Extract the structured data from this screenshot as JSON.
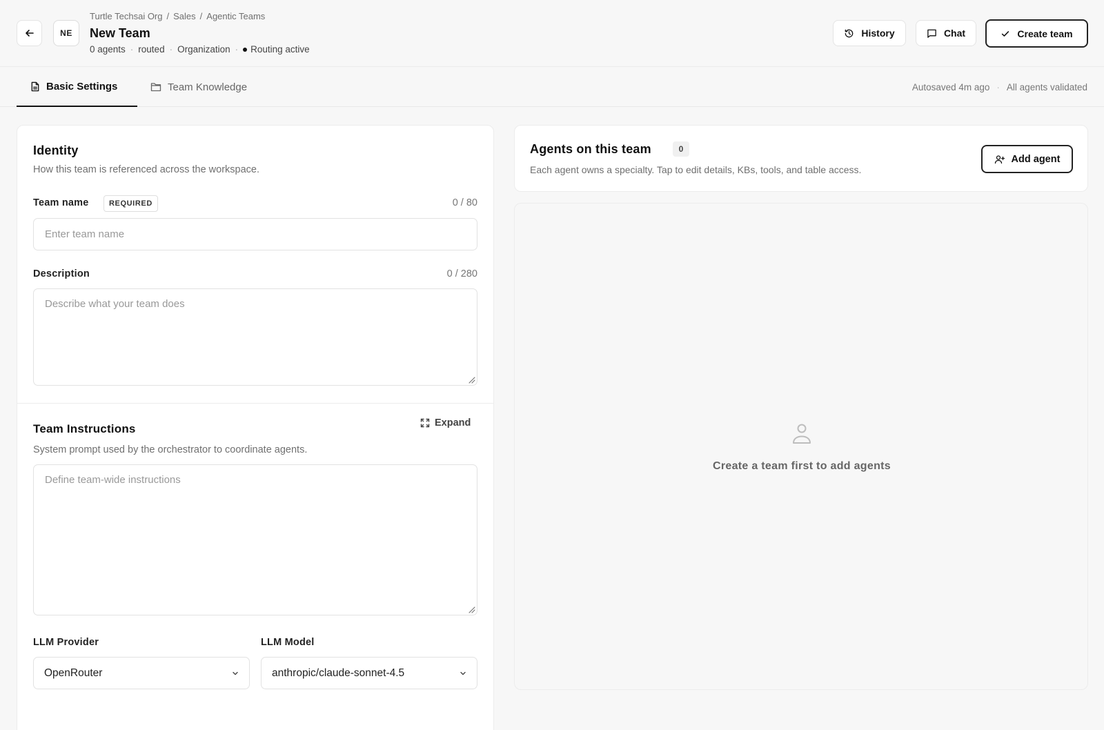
{
  "header": {
    "breadcrumb": [
      "Turtle Techsai Org",
      "/",
      "Sales",
      "/",
      "Agentic Teams"
    ],
    "avatar_initials": "NE",
    "title": "New Team",
    "meta": {
      "agents": "0 agents",
      "mode": "routed",
      "scope": "Organization",
      "routing": "Routing active"
    },
    "buttons": {
      "history": "History",
      "chat": "Chat",
      "create": "Create team"
    }
  },
  "tabs": {
    "basic": "Basic Settings",
    "knowledge": "Team Knowledge",
    "autosave": "Autosaved 4m ago",
    "validation": "All agents validated"
  },
  "identity": {
    "title": "Identity",
    "subtitle": "How this team is referenced across the workspace.",
    "team_name": {
      "label": "Team name",
      "badge": "REQUIRED",
      "counter": "0 / 80",
      "placeholder": "Enter team name"
    },
    "description": {
      "label": "Description",
      "counter": "0 / 280",
      "placeholder": "Describe what your team does"
    }
  },
  "instructions": {
    "title": "Team Instructions",
    "expand": "Expand",
    "subtitle": "System prompt used by the orchestrator to coordinate agents.",
    "placeholder": "Define team-wide instructions"
  },
  "llm": {
    "provider_label": "LLM Provider",
    "provider_value": "OpenRouter",
    "model_label": "LLM Model",
    "model_value": "anthropic/claude-sonnet-4.5"
  },
  "agents": {
    "title": "Agents on this team",
    "count": "0",
    "subtitle": "Each agent owns a specialty. Tap to edit details, KBs, tools, and table access.",
    "add_button": "Add agent",
    "empty_message": "Create a team first to add agents"
  },
  "icons": {
    "back": "arrow-left-icon",
    "history": "history-icon",
    "chat": "chat-bubble-icon",
    "create": "check-icon",
    "basic_tab": "document-icon",
    "knowledge_tab": "folder-icon",
    "expand": "expand-icon",
    "add_agent": "user-plus-icon",
    "empty": "user-icon"
  },
  "colors": {
    "background": "#f7f7f7",
    "card": "#ffffff",
    "text_primary": "#111111",
    "text_muted": "#707070",
    "border": "#e2e2e2"
  }
}
